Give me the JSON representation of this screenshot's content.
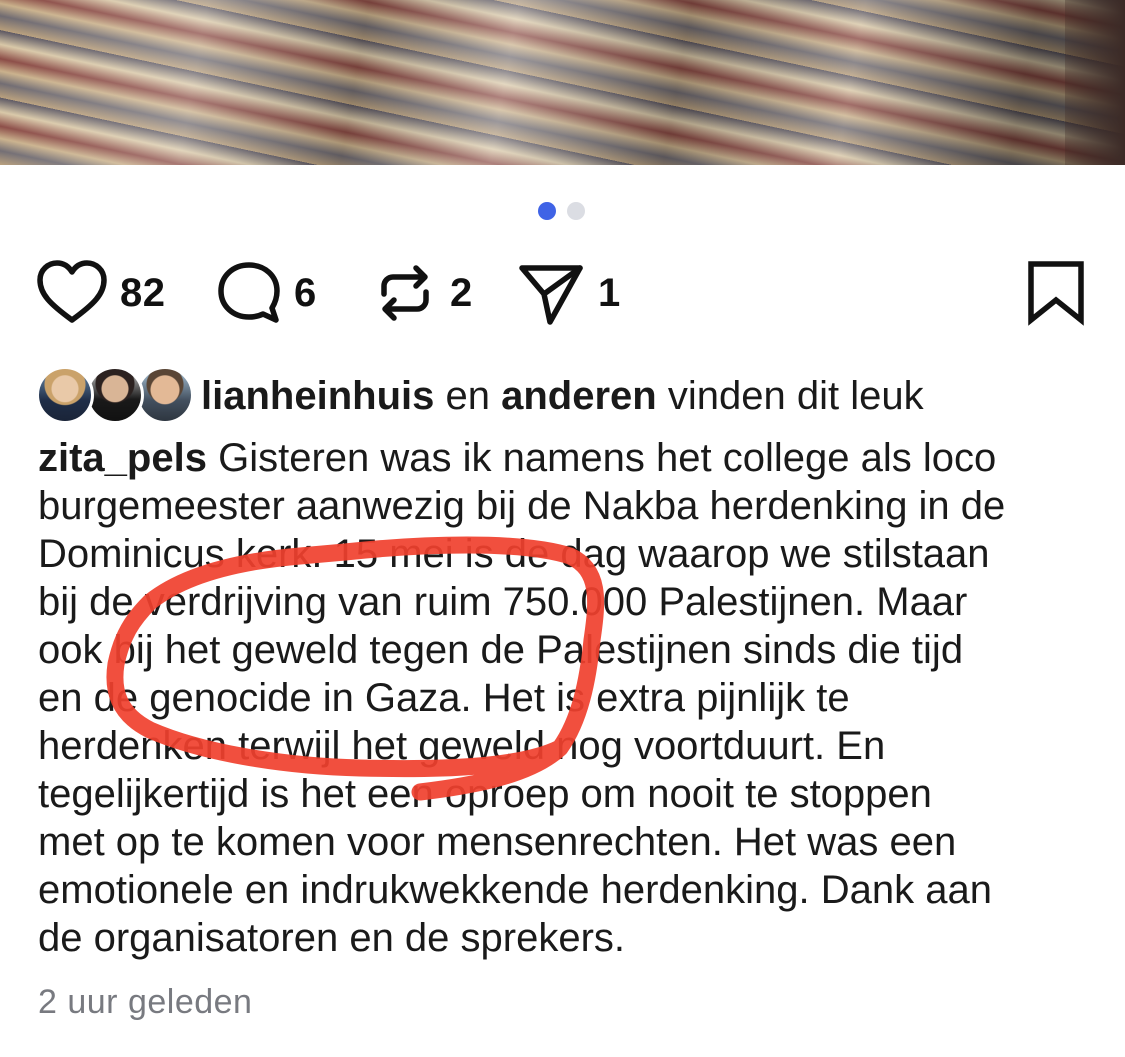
{
  "post": {
    "carousel": {
      "total": 2,
      "active_index": 0
    },
    "actions": {
      "likes": "82",
      "comments": "6",
      "reposts": "2",
      "shares": "1"
    },
    "liked_by": {
      "first_user": "lianheinhuis",
      "connector": "en",
      "others": "anderen",
      "suffix": "vinden dit leuk"
    },
    "caption": {
      "username": "zita_pels",
      "lines": [
        " Gisteren was ik namens het college als loco",
        "burgemeester aanwezig bij de Nakba herdenking in de",
        "Dominicus kerk. 15 mei is de dag waarop we stilstaan",
        "bij de verdrijving van ruim 750.000 Palestijnen. Maar",
        "ook bij het geweld tegen de Palestijnen sinds die tijd",
        "en de genocide in Gaza. Het is extra pijnlijk te",
        "herdenken terwijl het geweld nog voortduurt. En",
        "tegelijkertijd is het een oproep om nooit te stoppen",
        "met op te komen voor mensenrechten. Het was een",
        "emotionele en indrukwekkende herdenking. Dank aan",
        "de organisatoren en de sprekers."
      ]
    },
    "timestamp": "2 uur geleden"
  },
  "colors": {
    "accent_dot": "#3f63e6",
    "inactive_dot": "#dbdde3",
    "annotation_red": "#f0402e",
    "timestamp_gray": "#787a80"
  },
  "icons": {
    "like": "heart-icon",
    "comment": "comment-bubble-icon",
    "repost": "repost-arrows-icon",
    "share": "send-paper-plane-icon",
    "save": "bookmark-icon"
  }
}
